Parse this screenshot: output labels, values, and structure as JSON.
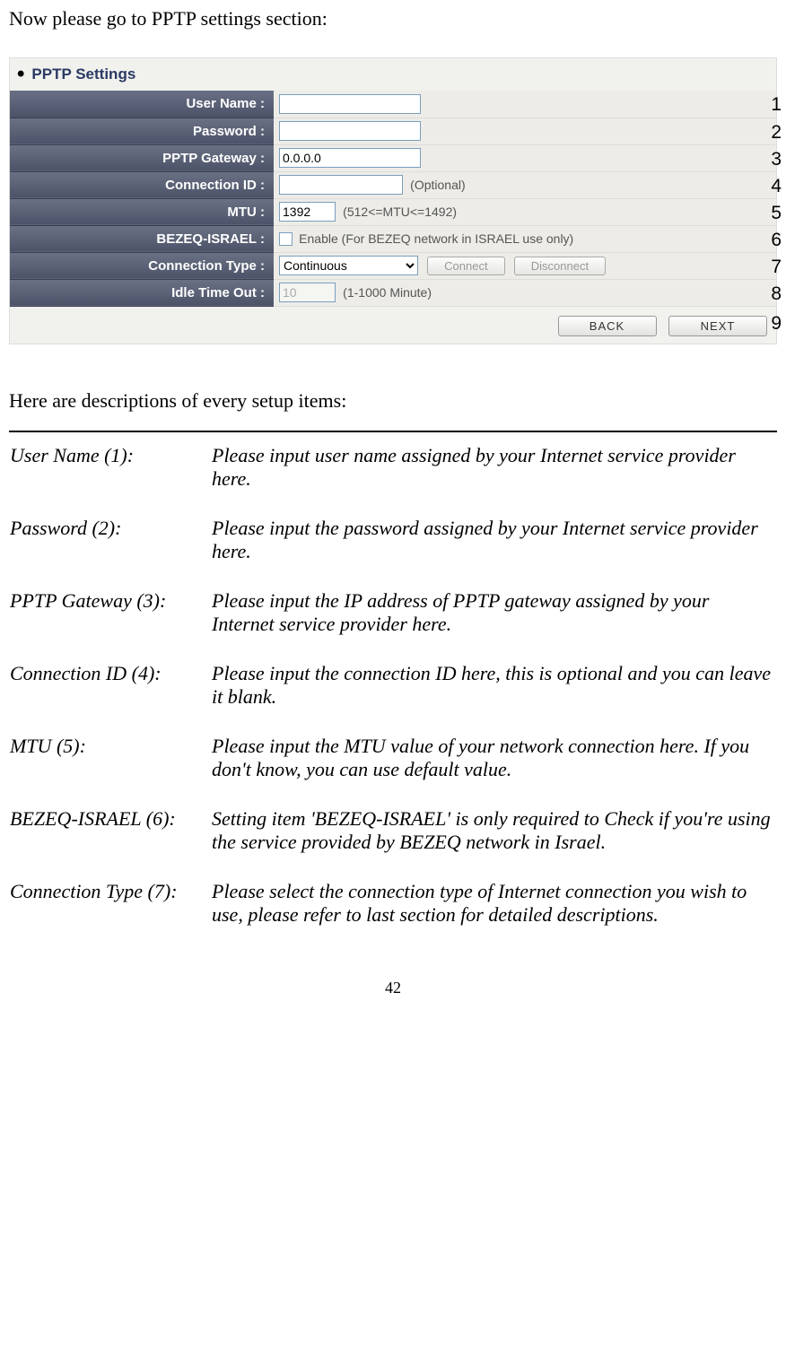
{
  "intro": "Now please go to PPTP settings section:",
  "screenshot": {
    "header": "PPTP Settings",
    "rows": [
      {
        "label": "User Name :",
        "value": "",
        "hint": "",
        "num": "1",
        "type": "text-wide"
      },
      {
        "label": "Password :",
        "value": "",
        "hint": "",
        "num": "2",
        "type": "password-wide"
      },
      {
        "label": "PPTP Gateway :",
        "value": "0.0.0.0",
        "hint": "",
        "num": "3",
        "type": "text-wide"
      },
      {
        "label": "Connection ID :",
        "value": "",
        "hint": "(Optional)",
        "num": "4",
        "type": "text-med"
      },
      {
        "label": "MTU :",
        "value": "1392",
        "hint": "(512<=MTU<=1492)",
        "num": "5",
        "type": "text-short"
      },
      {
        "label": "BEZEQ-ISRAEL :",
        "checkbox_label": "Enable (For BEZEQ network in ISRAEL use only)",
        "num": "6",
        "type": "checkbox"
      },
      {
        "label": "Connection Type :",
        "selected": "Continuous",
        "btn1": "Connect",
        "btn2": "Disconnect",
        "num": "7",
        "type": "select"
      },
      {
        "label": "Idle Time Out :",
        "value": "10",
        "hint": "(1-1000 Minute)",
        "num": "8",
        "type": "text-short-disabled"
      }
    ],
    "nav": {
      "back": "BACK",
      "next": "NEXT",
      "num": "9"
    }
  },
  "desc_header": "Here are descriptions of every setup items:",
  "descriptions": [
    {
      "term": "User Name (1):",
      "text": "Please input user name assigned by your Internet service provider here."
    },
    {
      "term": "Password (2):",
      "text": "Please input the password assigned by your Internet service provider here."
    },
    {
      "term": "PPTP Gateway (3):",
      "text": "Please input the IP address of PPTP gateway assigned by your Internet service provider here."
    },
    {
      "term": "Connection ID (4):",
      "text": "Please input the connection ID here, this is optional and you can leave it blank."
    },
    {
      "term": "MTU (5):",
      "text": "Please input the MTU value of your network connection here. If you don't know, you can use default value."
    },
    {
      "term": "BEZEQ-ISRAEL (6):",
      "text": "Setting item 'BEZEQ-ISRAEL' is only required to Check if you're using the service provided by BEZEQ network in Israel."
    },
    {
      "term": "Connection Type (7):",
      "text": "Please select the connection type of Internet connection you wish to use, please refer to last section for detailed descriptions."
    }
  ],
  "page_num": "42"
}
